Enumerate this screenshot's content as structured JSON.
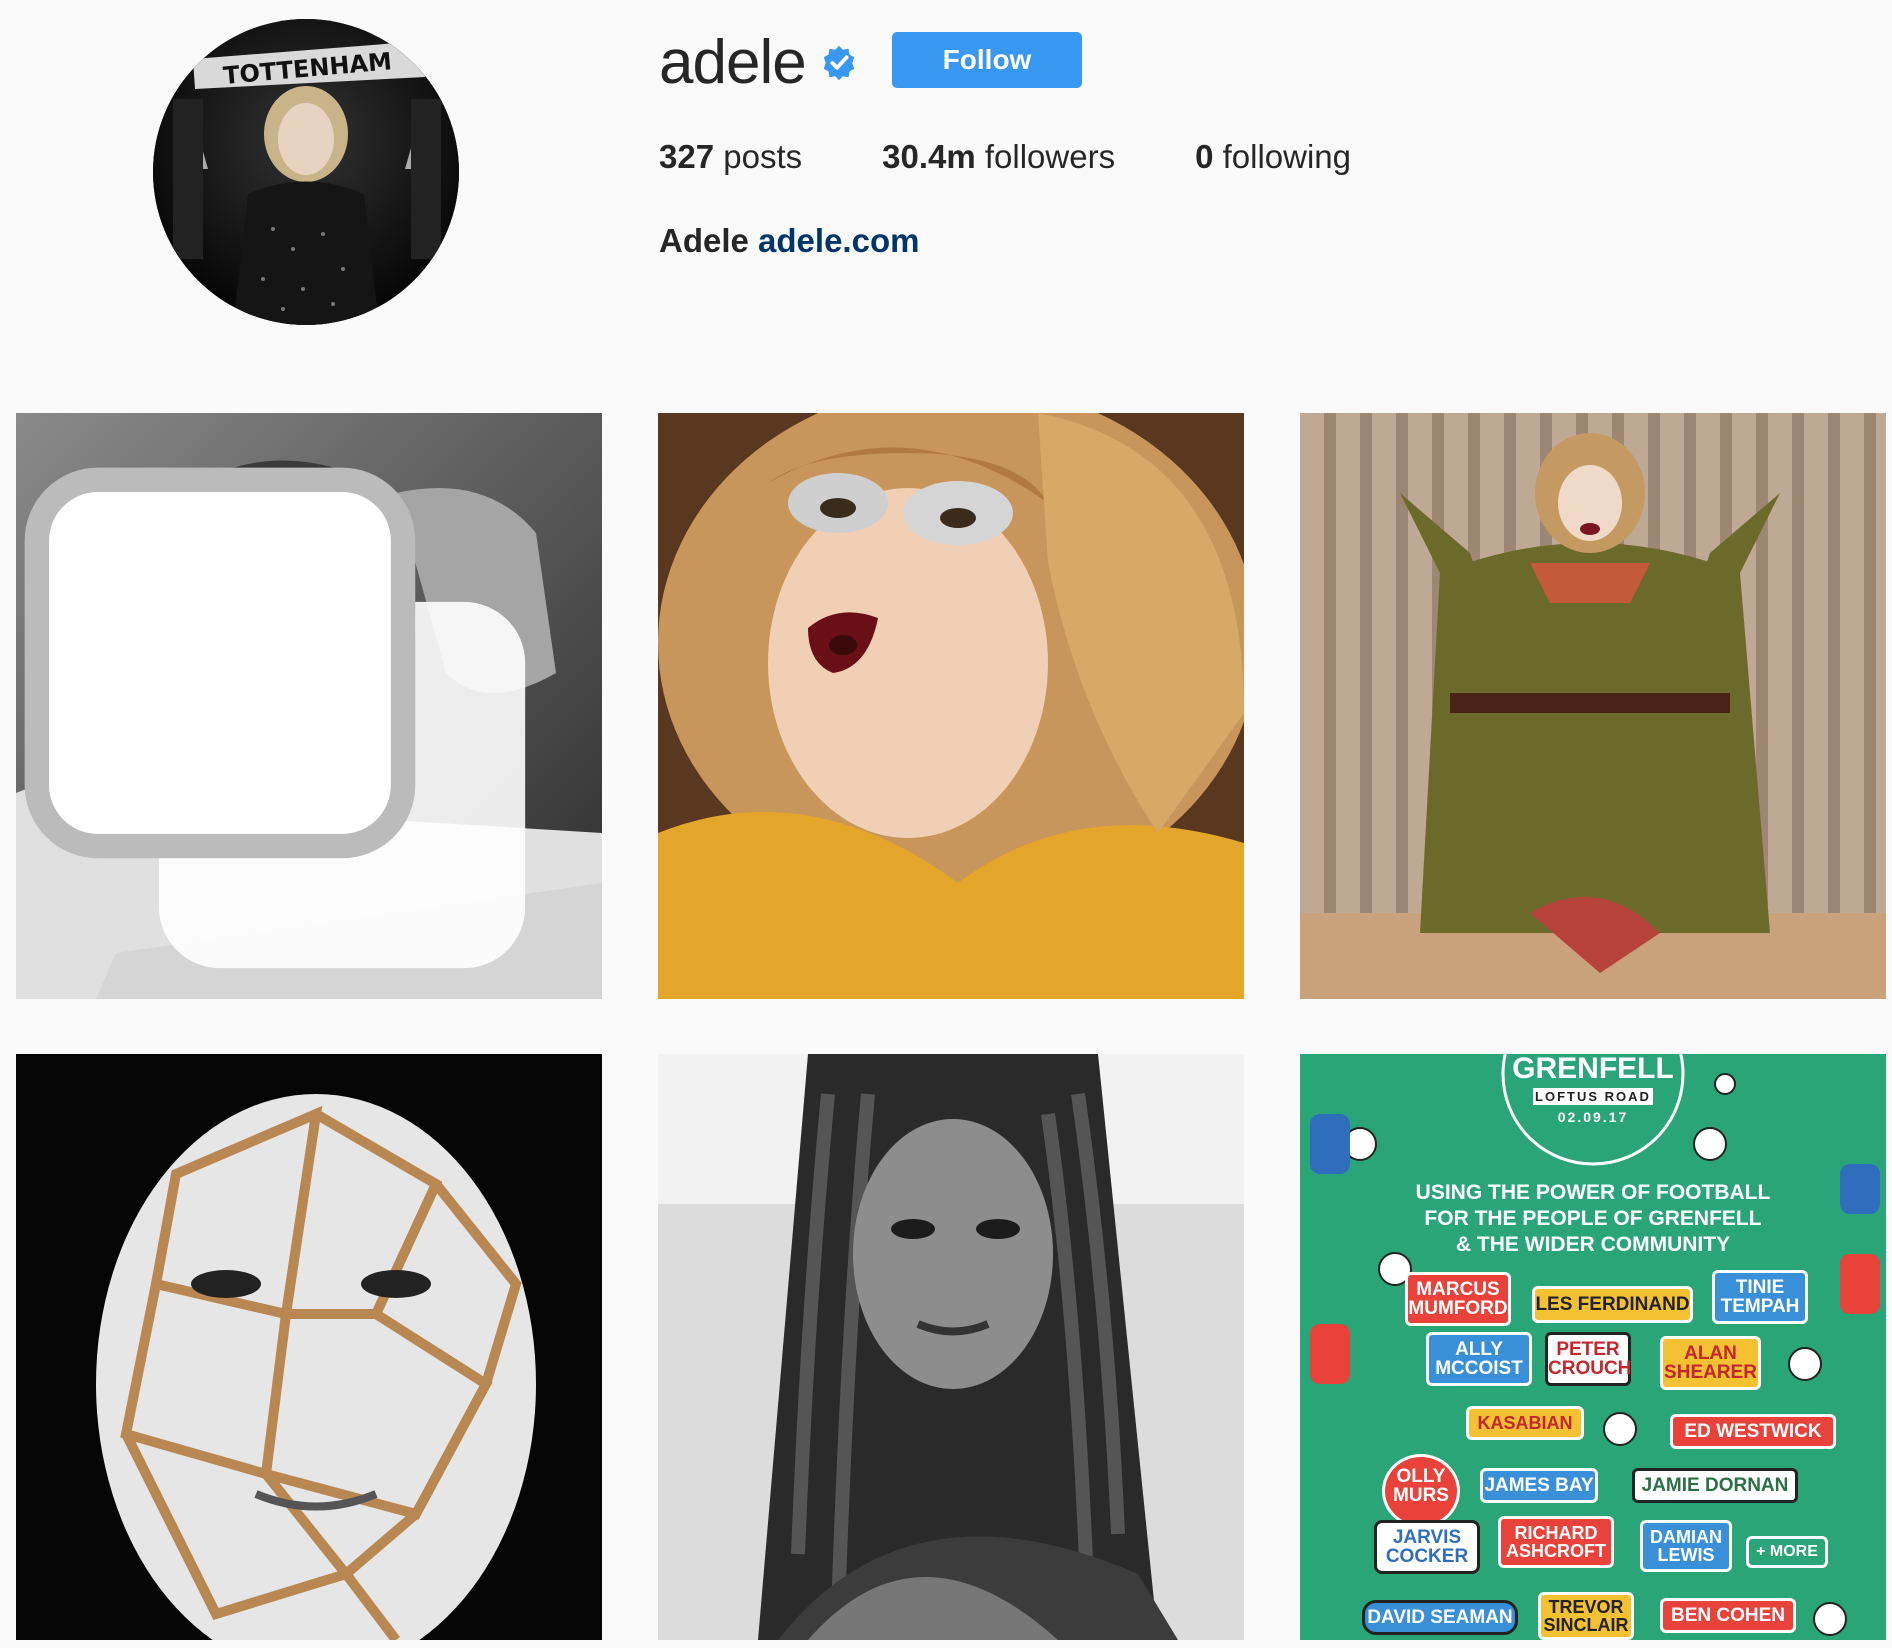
{
  "profile": {
    "username": "adele",
    "follow_label": "Follow",
    "posts_count": "327",
    "posts_label": "posts",
    "followers_count": "30.4m",
    "followers_label": "followers",
    "following_count": "0",
    "following_label": "following",
    "full_name": "Adele",
    "website": "adele.com",
    "avatar_scarf_text": "TOTTENHAM"
  },
  "colors": {
    "follow_button": "#3897f0",
    "link": "#003569",
    "verified": "#3897f0",
    "background": "#fafafa",
    "poster_green": "#2aa578"
  },
  "poster": {
    "title": "GRENFELL",
    "venue": "LOFTUS ROAD",
    "date": "02.09.17",
    "tagline_1": "USING THE POWER OF FOOTBALL",
    "tagline_2": "FOR THE PEOPLE OF GRENFELL",
    "tagline_3": "& THE WIDER COMMUNITY",
    "names": [
      "MARCUS\nMUMFORD",
      "LES FERDINAND",
      "TINIE\nTEMPAH",
      "ALLY\nMCCOIST",
      "PETER\nCROUCH",
      "ALAN\nSHEARER",
      "KASABIAN",
      "ED WESTWICK",
      "OLLY\nMURS",
      "JAMES BAY",
      "JAMIE DORNAN",
      "JARVIS\nCOCKER",
      "RICHARD\nASHCROFT",
      "DAMIAN\nLEWIS",
      "+ MORE",
      "DAVID SEAMAN",
      "TREVOR\nSINCLAIR",
      "BEN COHEN"
    ]
  },
  "posts": [
    {
      "icon": "multiple-photos-icon"
    },
    {},
    {},
    {},
    {},
    {}
  ]
}
